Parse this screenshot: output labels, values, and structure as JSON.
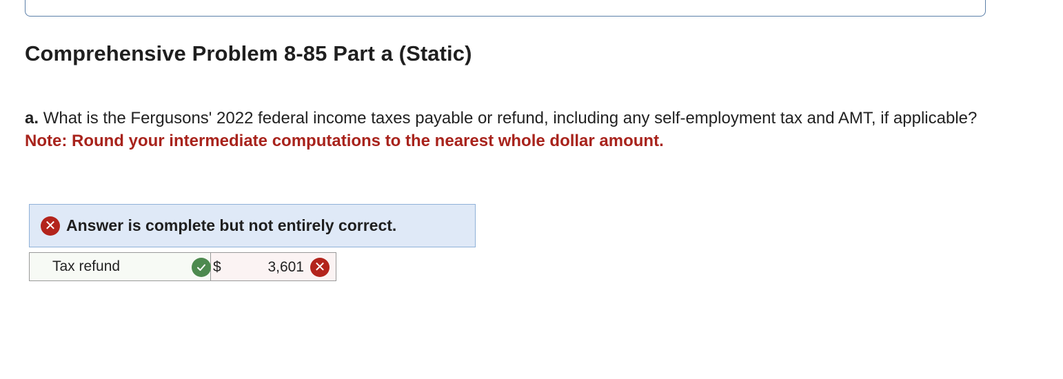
{
  "title": "Comprehensive Problem 8-85 Part a (Static)",
  "question": {
    "part_label": "a.",
    "text": "What is the Fergusons' 2022 federal income taxes payable or refund, including any self-employment tax and AMT, if applicable?",
    "note": "Note: Round your intermediate computations to the nearest whole dollar amount."
  },
  "feedback": {
    "status_icon": "x-circle-icon",
    "message": "Answer is complete but not entirely correct."
  },
  "answer_table": {
    "rows": [
      {
        "label": "Tax refund",
        "label_status_icon": "check-circle-icon",
        "currency": "$",
        "value": "3,601",
        "value_status_icon": "x-circle-icon"
      }
    ]
  },
  "colors": {
    "error_red": "#b3241c",
    "note_red": "#a8231c",
    "correct_green": "#4d8a4f",
    "banner_blue": "#dfe9f7"
  }
}
